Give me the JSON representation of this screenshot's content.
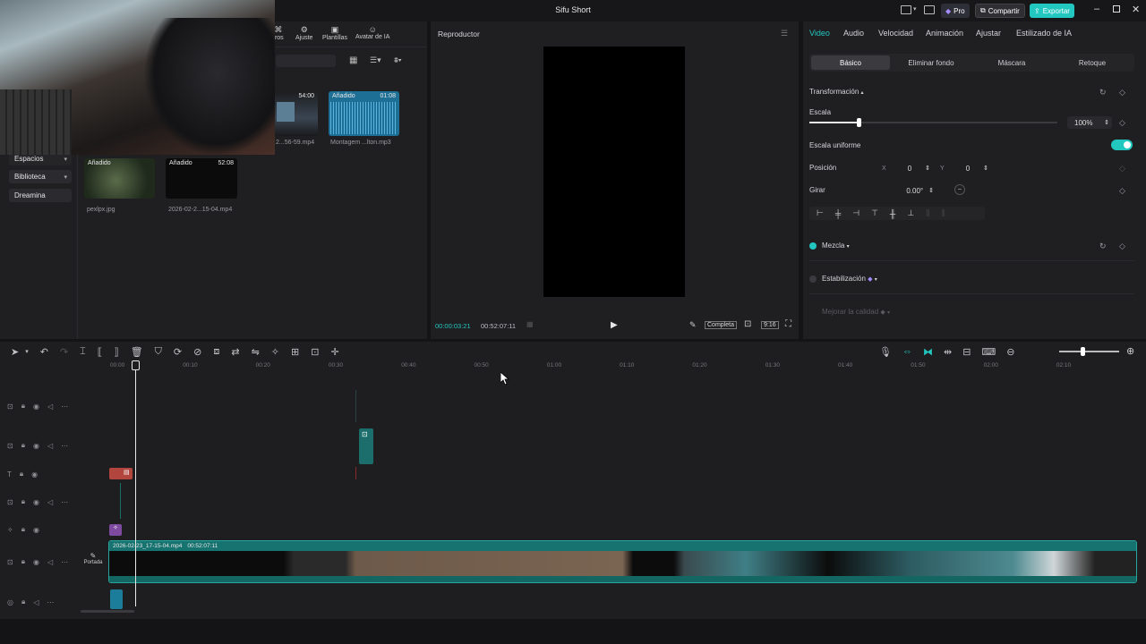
{
  "app": {
    "title": "Sifu Short"
  },
  "titlebar": {
    "pro_label": "Pro",
    "share_label": "Compartir",
    "export_label": "Exportar"
  },
  "top_toolbar": {
    "items": [
      "tros",
      "Ajuste",
      "Plantillas",
      "Avatar de IA"
    ]
  },
  "sidebar": {
    "items": [
      "Espacios",
      "Biblioteca",
      "Dreamina"
    ]
  },
  "media": {
    "items": [
      {
        "tag": "",
        "duration": "54:00",
        "caption": "2...56-59.mp4"
      },
      {
        "tag": "Añadido",
        "duration": "01:08",
        "caption": "Montagem ...lton.mp3"
      },
      {
        "tag": "Añadido",
        "duration": "",
        "caption": "pexlpx.jpg"
      },
      {
        "tag": "Añadido",
        "duration": "52:08",
        "caption": "2026-02-2...15-04.mp4"
      }
    ]
  },
  "player": {
    "title": "Reproductor",
    "current_time": "00:00:03:21",
    "total_time": "00:52:07:11",
    "quality_label": "Completa",
    "ratio_label": "9:16"
  },
  "props": {
    "tabs": [
      "Video",
      "Audio",
      "Velocidad",
      "Animación",
      "Ajustar",
      "Estilizado de IA"
    ],
    "active_tab": "Video",
    "subtabs": [
      "Básico",
      "Eliminar fondo",
      "Máscara",
      "Retoque"
    ],
    "transform_label": "Transformación",
    "scale_label": "Escala",
    "scale_value": "100%",
    "scale_fraction": 0.2,
    "uniform_scale_label": "Escala uniforme",
    "position_label": "Posición",
    "pos_x_label": "X",
    "pos_x": "0",
    "pos_y_label": "Y",
    "pos_y": "0",
    "rotate_label": "Girar",
    "rotate_value": "0.00°",
    "blend_label": "Mezcla",
    "stabilize_label": "Estabilización",
    "enhance_label": "Mejorar la calidad",
    "accent_color": "#22c7c0"
  },
  "timeline": {
    "ruler": [
      "00:00",
      "00:10",
      "00:20",
      "00:30",
      "00:40",
      "00:50",
      "01:00",
      "01:10",
      "01:20",
      "01:30",
      "01:40",
      "01:50",
      "02:00",
      "02:10"
    ],
    "main_clip_name": "2026-02-23_17-15-04.mp4",
    "main_clip_duration": "00:52:07:11",
    "cover_label": "Portada"
  }
}
